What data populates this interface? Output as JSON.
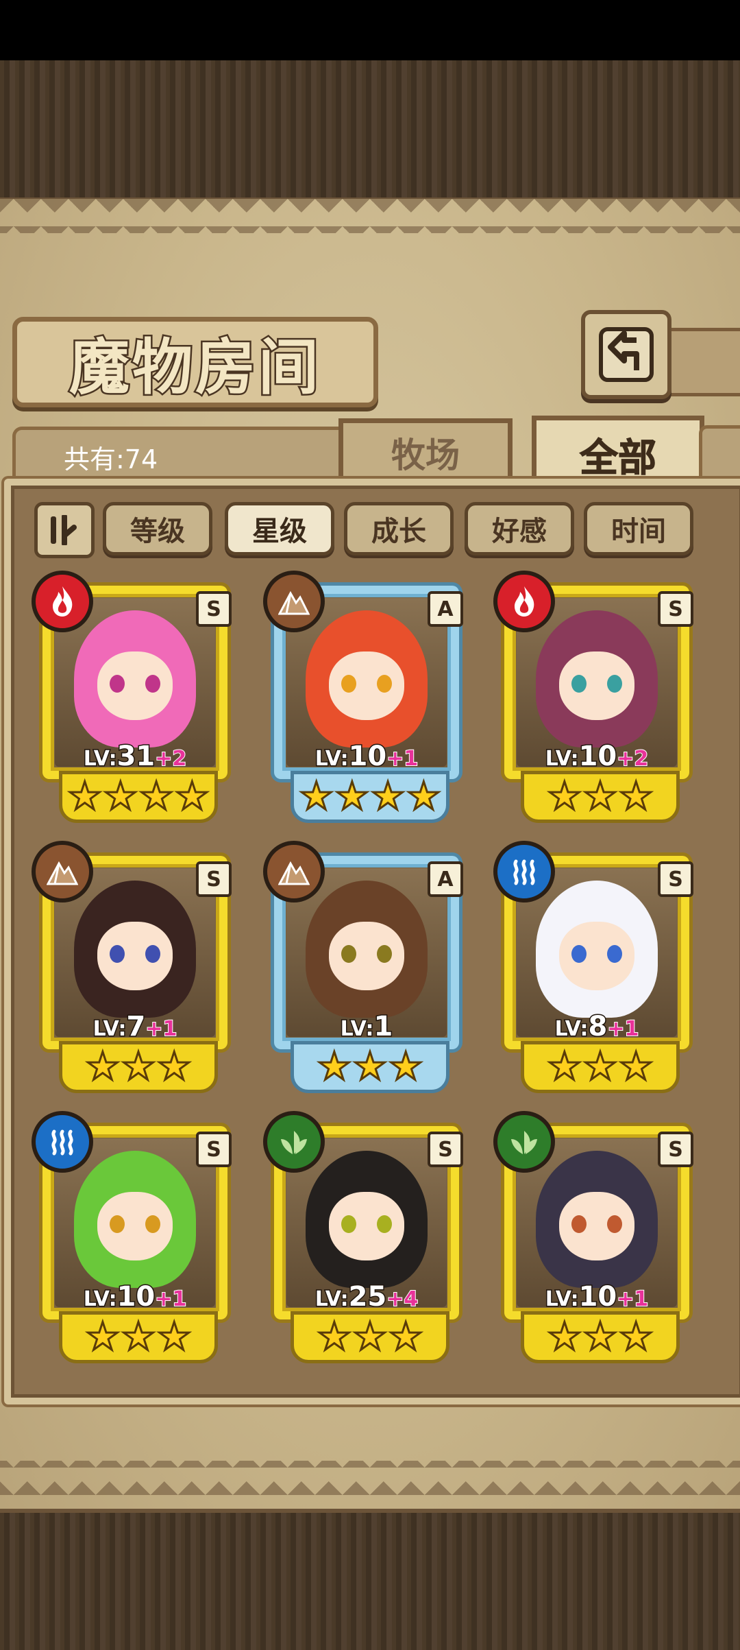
{
  "header": {
    "title": "魔物房间"
  },
  "tabs": {
    "count_text": "共有:74",
    "ranch": "牧场",
    "all": "全部",
    "selected": "全部"
  },
  "filters": {
    "items": [
      "等级",
      "星级",
      "成长",
      "好感",
      "时间"
    ],
    "active": "星级"
  },
  "monsters": [
    {
      "element": "fire",
      "element_icon": "fire-icon",
      "rank": "S",
      "level": "31",
      "bonus": "+2",
      "stars": 4,
      "frame": "gold",
      "hair": "#f06ab8",
      "eyes": "#c0358a"
    },
    {
      "element": "earth",
      "element_icon": "earth-icon",
      "rank": "A",
      "level": "10",
      "bonus": "+1",
      "stars": 4,
      "frame": "blue",
      "hair": "#e8502c",
      "eyes": "#e8a020"
    },
    {
      "element": "fire",
      "element_icon": "fire-icon",
      "rank": "S",
      "level": "10",
      "bonus": "+2",
      "stars": 3,
      "frame": "gold",
      "hair": "#8a3a5a",
      "eyes": "#3aa0a0"
    },
    {
      "element": "earth",
      "element_icon": "earth-icon",
      "rank": "S",
      "level": "7",
      "bonus": "+1",
      "stars": 3,
      "frame": "gold",
      "hair": "#3a2420",
      "eyes": "#4050b0"
    },
    {
      "element": "earth",
      "element_icon": "earth-icon",
      "rank": "A",
      "level": "1",
      "bonus": "",
      "stars": 3,
      "frame": "blue",
      "hair": "#6a4228",
      "eyes": "#8a7a20"
    },
    {
      "element": "water",
      "element_icon": "water-icon",
      "rank": "S",
      "level": "8",
      "bonus": "+1",
      "stars": 3,
      "frame": "gold",
      "hair": "#f4f4fa",
      "eyes": "#3a6ad0"
    },
    {
      "element": "water",
      "element_icon": "water-icon",
      "rank": "S",
      "level": "10",
      "bonus": "+1",
      "stars": 3,
      "frame": "gold",
      "hair": "#6ac83a",
      "eyes": "#d89a20"
    },
    {
      "element": "wood",
      "element_icon": "leaf-icon",
      "rank": "S",
      "level": "25",
      "bonus": "+4",
      "stars": 3,
      "frame": "gold",
      "hair": "#24201e",
      "eyes": "#a8b020"
    },
    {
      "element": "wood",
      "element_icon": "leaf-icon",
      "rank": "S",
      "level": "10",
      "bonus": "+1",
      "stars": 3,
      "frame": "gold",
      "hair": "#3a3448",
      "eyes": "#c05a30"
    }
  ]
}
